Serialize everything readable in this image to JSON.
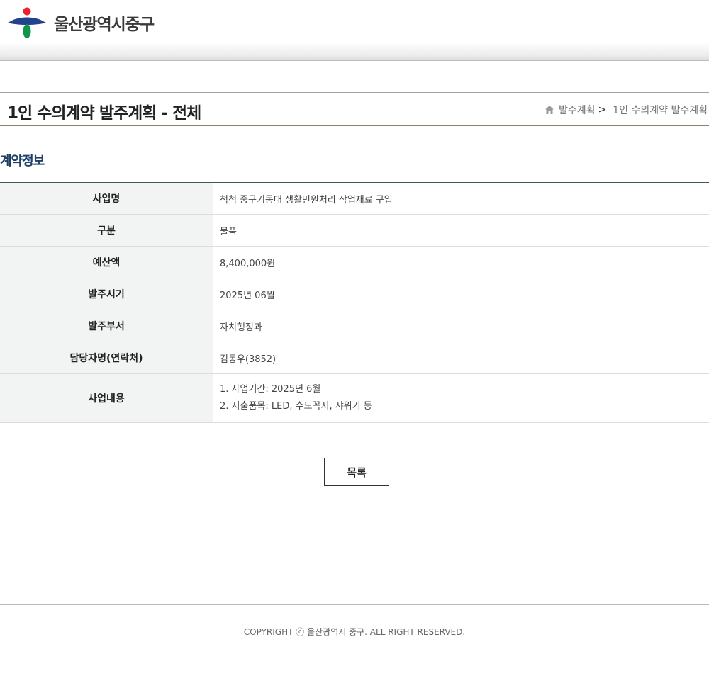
{
  "header": {
    "logo_text": "울산광역시중구",
    "colors": {
      "red": "#e8232b",
      "blue": "#22438f",
      "green": "#12954a"
    }
  },
  "title_bar": {
    "title": "1인 수의계약 발주계획 - 전체",
    "breadcrumb": {
      "home_icon": "home-icon",
      "item1": "발주계획",
      "separator": ">",
      "item2": "1인 수의계약 발주계획"
    }
  },
  "section": {
    "title": "계약정보"
  },
  "contract": {
    "rows": [
      {
        "label": "사업명",
        "value": "척척 중구기동대 생활민원처리 작업재료 구입"
      },
      {
        "label": "구분",
        "value": "물품"
      },
      {
        "label": "예산액",
        "value": "8,400,000원"
      },
      {
        "label": "발주시기",
        "value": "2025년 06월"
      },
      {
        "label": "발주부서",
        "value": "자치행정과"
      },
      {
        "label": "담당자명(연락처)",
        "value": "김동우(3852)"
      },
      {
        "label": "사업내용",
        "lines": [
          "1. 사업기간: 2025년 6월",
          "2. 지출품목: LED, 수도꼭지, 샤워기 등"
        ]
      }
    ]
  },
  "buttons": {
    "list_label": "목록"
  },
  "footer": {
    "copyright": "COPYRIGHT ⓒ 울산광역시 중구. ALL RIGHT RESERVED."
  }
}
